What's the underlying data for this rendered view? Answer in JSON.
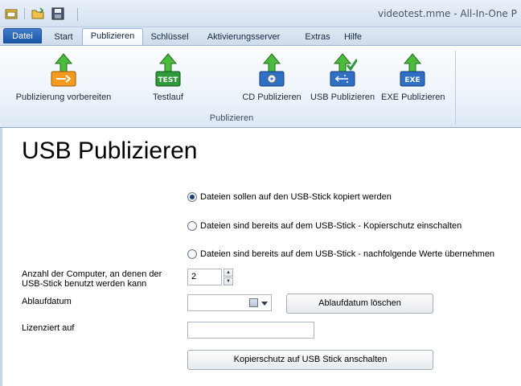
{
  "window": {
    "title": "videotest.mme  -  All-In-One P"
  },
  "tabs": [
    {
      "label": "Datei"
    },
    {
      "label": "Start"
    },
    {
      "label": "Publizieren"
    },
    {
      "label": "Schlüssel"
    },
    {
      "label": "Aktivierungsserver"
    },
    {
      "label": "Extras"
    },
    {
      "label": "Hilfe"
    }
  ],
  "ribbon": {
    "group_label": "Publizieren",
    "buttons": [
      {
        "label": "Publizierung vorbereiten",
        "icon": "prepare-publish-icon"
      },
      {
        "label": "Testlauf",
        "icon": "test-icon",
        "badge": "TEST"
      },
      {
        "label": "CD Publizieren",
        "icon": "cd-publish-icon"
      },
      {
        "label": "USB Publizieren",
        "icon": "usb-publish-icon"
      },
      {
        "label": "EXE Publizieren",
        "icon": "exe-publish-icon",
        "badge": "EXE"
      }
    ]
  },
  "main": {
    "title": "USB Publizieren",
    "options": [
      {
        "label": "Dateien sollen auf den USB-Stick kopiert werden",
        "checked": true
      },
      {
        "label": "Dateien sind bereits auf dem USB-Stick - Kopierschutz einschalten",
        "checked": false
      },
      {
        "label": "Dateien sind bereits auf dem USB-Stick - nachfolgende Werte übernehmen",
        "checked": false
      }
    ],
    "computers_label": "Anzahl der Computer, an denen der USB-Stick benutzt werden kann",
    "computers_value": "2",
    "expiry_label": "Ablaufdatum",
    "expiry_value": "",
    "clear_expiry_button": "Ablaufdatum löschen",
    "licensed_label": "Lizenziert auf",
    "licensed_value": "",
    "activate_button": "Kopierschutz auf USB Stick anschalten"
  },
  "colors": {
    "accent": "#1b57a8",
    "ribbon_bg": "#eef4fb",
    "arrow_green": "#3aa83a"
  }
}
